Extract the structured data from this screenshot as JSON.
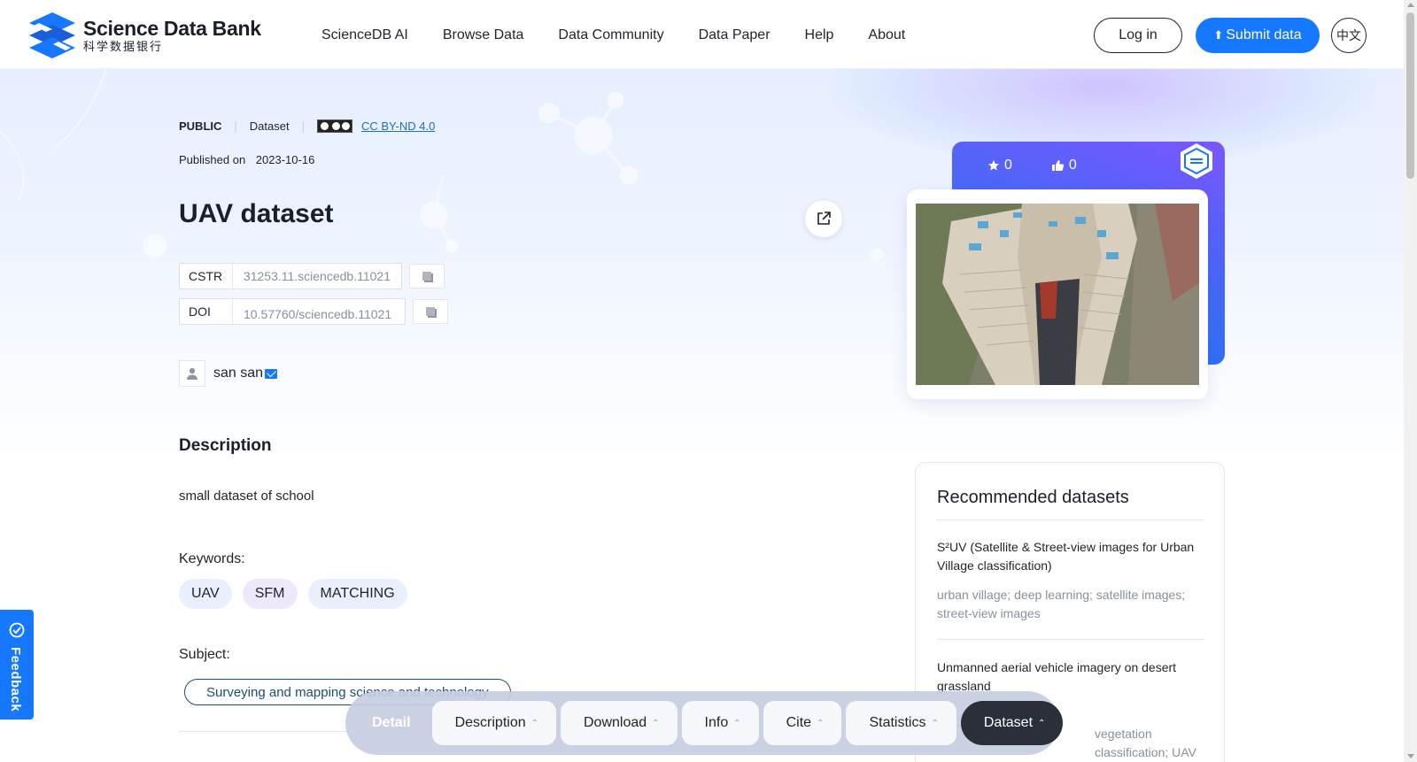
{
  "header": {
    "logo_en": "Science Data Bank",
    "logo_cn": "科学数据银行",
    "nav": [
      "ScienceDB AI",
      "Browse Data",
      "Data Community",
      "Data Paper",
      "Help",
      "About"
    ],
    "login_label": "Log in",
    "submit_label": "Submit data",
    "lang_label": "中文"
  },
  "dataset": {
    "access": "PUBLIC",
    "kind": "Dataset",
    "license": "CC BY-ND 4.0",
    "published_label": "Published on",
    "published_date": "2023-10-16",
    "title": "UAV dataset",
    "cstr_label": "CSTR",
    "cstr_value": "31253.11.sciencedb.11021",
    "doi_label": "DOI",
    "doi_value": "10.57760/sciencedb.11021",
    "author": "san san",
    "stars": "0",
    "likes": "0"
  },
  "description": {
    "heading": "Description",
    "text": "small dataset of school",
    "keywords_label": "Keywords:",
    "keywords": [
      "UAV",
      "SFM",
      "MATCHING"
    ],
    "subject_label": "Subject:",
    "subject": "Surveying and mapping science and technology"
  },
  "recommended": {
    "title": "Recommended datasets",
    "items": [
      {
        "title": "S²UV (Satellite & Street-view images for Urban Village classification)",
        "keywords": "urban village; deep learning; satellite images; street-view images"
      },
      {
        "title": "Unmanned aerial vehicle imagery on desert grassland",
        "keywords": "vegetation classification; UAV imagery"
      }
    ]
  },
  "feedback_label": "Feedback",
  "tabbar": {
    "detail": "Detail",
    "tabs": [
      "Description",
      "Download",
      "Info",
      "Cite",
      "Statistics",
      "Dataset"
    ]
  },
  "colors": {
    "primary": "#1677ff",
    "dark_tab": "#2b2f3a",
    "keyword_blue": "#e8f0fe",
    "keyword_purple": "#efe8fb"
  }
}
